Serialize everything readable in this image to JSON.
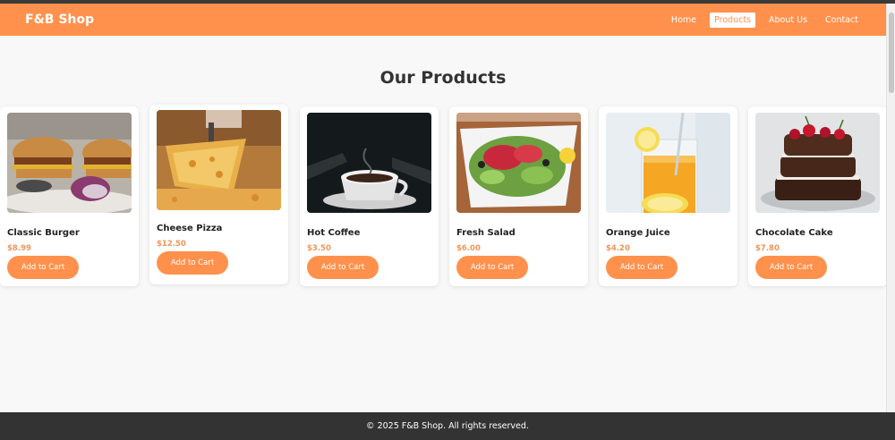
{
  "header": {
    "brand": "F&B Shop",
    "nav": [
      "Home",
      "Products",
      "About Us",
      "Contact"
    ],
    "active_nav": "Products",
    "accent_color": "#ff914d"
  },
  "main": {
    "title": "Our Products",
    "products": [
      {
        "name": "Classic Burger",
        "price": "$8.99",
        "button": "Add to Cart",
        "image": "burger-image"
      },
      {
        "name": "Cheese Pizza",
        "price": "$12.50",
        "button": "Add to Cart",
        "image": "pizza-image"
      },
      {
        "name": "Hot Coffee",
        "price": "$3.50",
        "button": "Add to Cart",
        "image": "coffee-image"
      },
      {
        "name": "Fresh Salad",
        "price": "$6.00",
        "button": "Add to Cart",
        "image": "salad-image"
      },
      {
        "name": "Orange Juice",
        "price": "$4.20",
        "button": "Add to Cart",
        "image": "juice-image"
      },
      {
        "name": "Chocolate Cake",
        "price": "$7.80",
        "button": "Add to Cart",
        "image": "cake-image"
      }
    ]
  },
  "footer": {
    "text": "© 2025 F&B Shop. All rights reserved."
  }
}
